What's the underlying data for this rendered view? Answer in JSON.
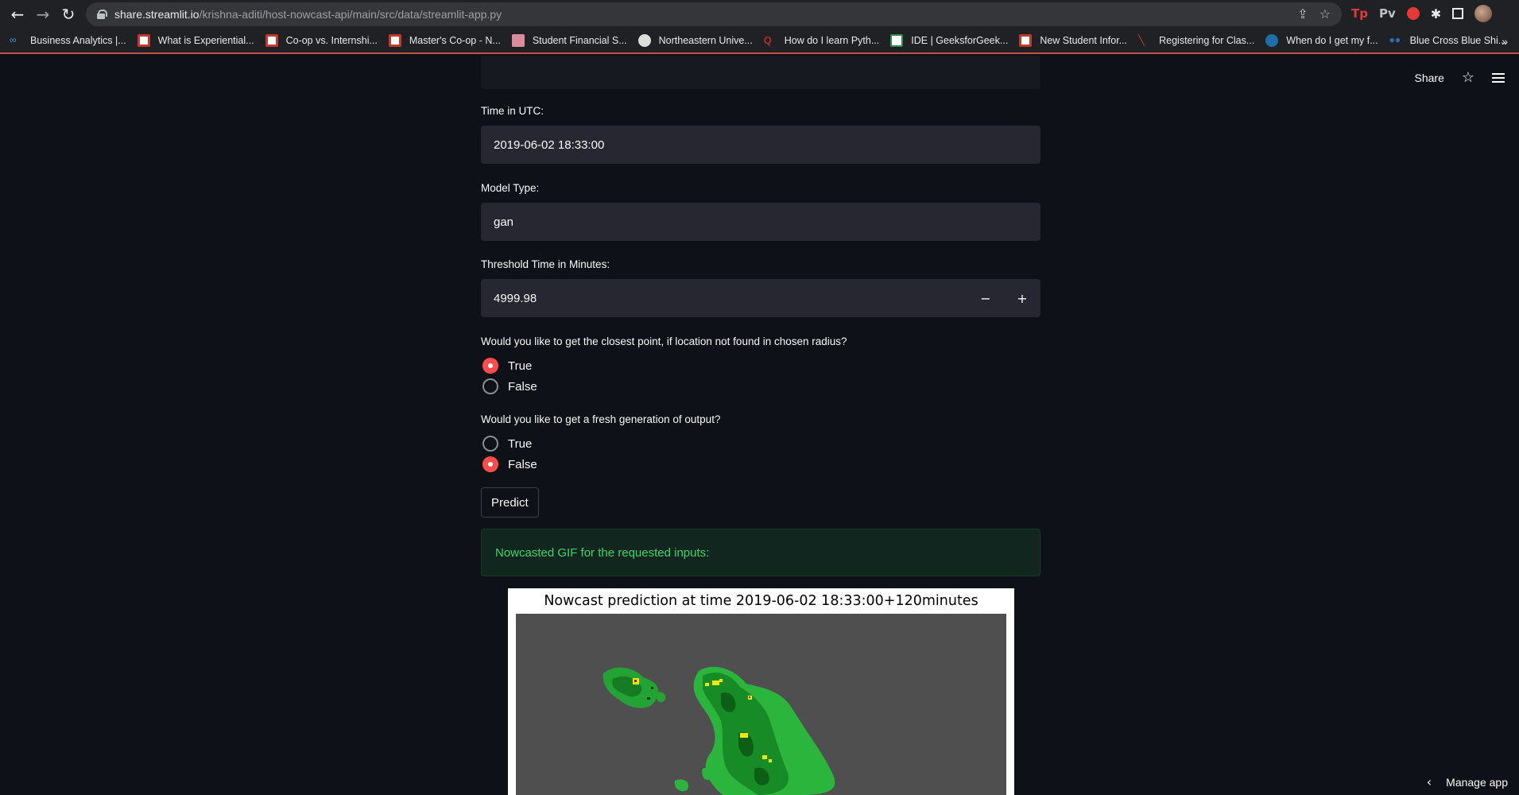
{
  "browser": {
    "url_host": "share.streamlit.io",
    "url_path": "/krishna-aditi/host-nowcast-api/main/src/data/streamlit-app.py",
    "extensions": [
      "Tp",
      "Pv"
    ],
    "bookmarks": [
      {
        "label": "Business Analytics |...",
        "color": "#4a90e2"
      },
      {
        "label": "What is Experiential...",
        "color": "#c0392b"
      },
      {
        "label": "Co-op vs. Internshi...",
        "color": "#c0392b"
      },
      {
        "label": "Master's Co-op - N...",
        "color": "#c0392b"
      },
      {
        "label": "Student Financial S...",
        "color": "#d98c9b"
      },
      {
        "label": "Northeastern Unive...",
        "color": "#dddddd"
      },
      {
        "label": "How do I learn Pyth...",
        "color": "#b92b27"
      },
      {
        "label": "IDE | GeeksforGeek...",
        "color": "#2f8d46"
      },
      {
        "label": "New Student Infor...",
        "color": "#c0392b"
      },
      {
        "label": "Registering for Clas...",
        "color": "#c0392b"
      },
      {
        "label": "When do I get my f...",
        "color": "#1e6fa8"
      },
      {
        "label": "Blue Cross Blue Shi...",
        "color": "#2c6fb5"
      }
    ],
    "more": "»"
  },
  "header": {
    "share_label": "Share",
    "star_icon": "☆"
  },
  "form": {
    "time_label": "Time in UTC:",
    "time_value": "2019-06-02 18:33:00",
    "model_label": "Model Type:",
    "model_value": "gan",
    "threshold_label": "Threshold Time in Minutes:",
    "threshold_value": "4999.98",
    "minus": "−",
    "plus": "+",
    "closest_question": "Would you like to get the closest point, if location not found in chosen radius?",
    "closest_options": [
      "True",
      "False"
    ],
    "closest_selected": "True",
    "fresh_question": "Would you like to get a fresh generation of output?",
    "fresh_options": [
      "True",
      "False"
    ],
    "fresh_selected": "False",
    "predict_label": "Predict"
  },
  "result": {
    "success_message": "Nowcasted GIF for the requested inputs:",
    "gif_title": "Nowcast prediction at time 2019-06-02 18:33:00+120minutes"
  },
  "footer": {
    "manage_label": "Manage app"
  },
  "colors": {
    "accent": "#ff4b4b",
    "background": "#0e1117",
    "success_text": "#3dd56d"
  }
}
